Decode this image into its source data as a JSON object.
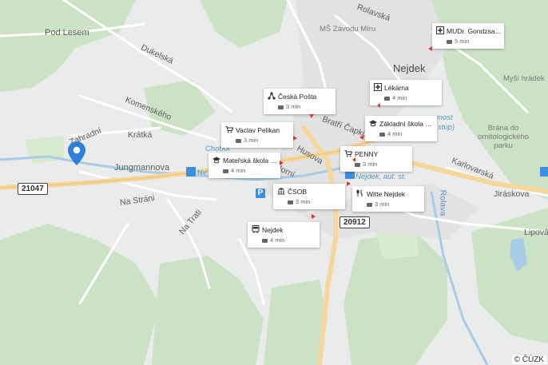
{
  "map": {
    "copyright": "© ČÚZK",
    "route_numbers": [
      "21047",
      "20912"
    ],
    "town_labels": [
      "Nejdek"
    ],
    "road_labels": [
      "Pod Lesem",
      "Dukelská",
      "Komenského",
      "Krátká",
      "Zahradní",
      "Jungmannova",
      "Na Stráni",
      "Na Trati",
      "Husova",
      "Horní",
      "Bratří Čapků",
      "Rolavská",
      "Karlovarská",
      "Jiráskova",
      "Lipová",
      "Rolava",
      "Chobot",
      "Ne"
    ],
    "poi_labels": [
      "MŠ Závodu Míru",
      "Myší hrádek",
      "Brána do ornitologického parku",
      "Nejdek, aut. st.",
      "most",
      "stup)"
    ],
    "parking_symbol": "P",
    "colors": {
      "accent": "#2f7fd8",
      "forest": "#c9e1c3",
      "water": "#a9cbe8",
      "road": "#ffffff",
      "major_road": "#f7d99a"
    }
  },
  "location_pin": {
    "icon": "location-pin-icon"
  },
  "places": [
    {
      "name": "MUDr. Gondzsalo…",
      "time": "5 min",
      "icon": "medical-cross-icon"
    },
    {
      "name": "Lékárna",
      "time": "4 min",
      "icon": "pharmacy-icon"
    },
    {
      "name": "Česká Pošta",
      "time": "3 min",
      "icon": "post-office-icon"
    },
    {
      "name": "Základní škola N…",
      "time": "4 min",
      "icon": "school-icon"
    },
    {
      "name": "Vaclav Pelikan",
      "time": "3 min",
      "icon": "shopping-cart-icon"
    },
    {
      "name": "PENNY",
      "time": "3 min",
      "icon": "shopping-cart-icon"
    },
    {
      "name": "Mateřská škola N…",
      "time": "4 min",
      "icon": "school-icon"
    },
    {
      "name": "ČSOB",
      "time": "3 min",
      "icon": "bank-icon"
    },
    {
      "name": "Witte Nejdek",
      "time": "3 min",
      "icon": "restaurant-icon"
    },
    {
      "name": "Nejdek",
      "time": "4 min",
      "icon": "bus-icon"
    }
  ]
}
